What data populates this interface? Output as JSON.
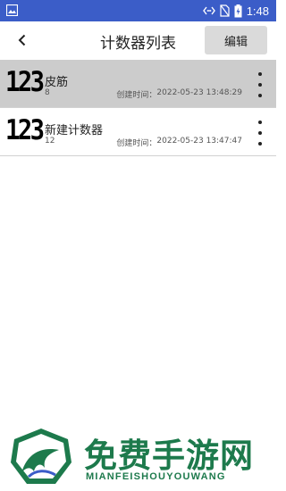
{
  "status_bar": {
    "time": "1:48",
    "icons": [
      "image-notification-icon",
      "data-transfer-icon",
      "no-sim-icon",
      "battery-charging-icon"
    ]
  },
  "app_bar": {
    "title": "计数器列表",
    "edit_label": "编辑",
    "back_icon": "chevron-left-icon"
  },
  "counters": [
    {
      "logo": "123",
      "name": "皮筋",
      "value": "8",
      "created_label": "创建时间：",
      "created_at": "2022-05-23 13:48:29",
      "selected": true
    },
    {
      "logo": "123",
      "name": "新建计数器",
      "value": "12",
      "created_label": "创建时间：",
      "created_at": "2022-05-23 13:47:47",
      "selected": false
    }
  ],
  "watermark": {
    "title": "免费手游网",
    "subtitle": "MIANFEISHOUYOUWANG"
  },
  "colors": {
    "status_bar": "#3b5dc8",
    "selected_row": "#cccccc",
    "edit_button": "#dadada",
    "watermark_green": "#1d7a4c"
  }
}
